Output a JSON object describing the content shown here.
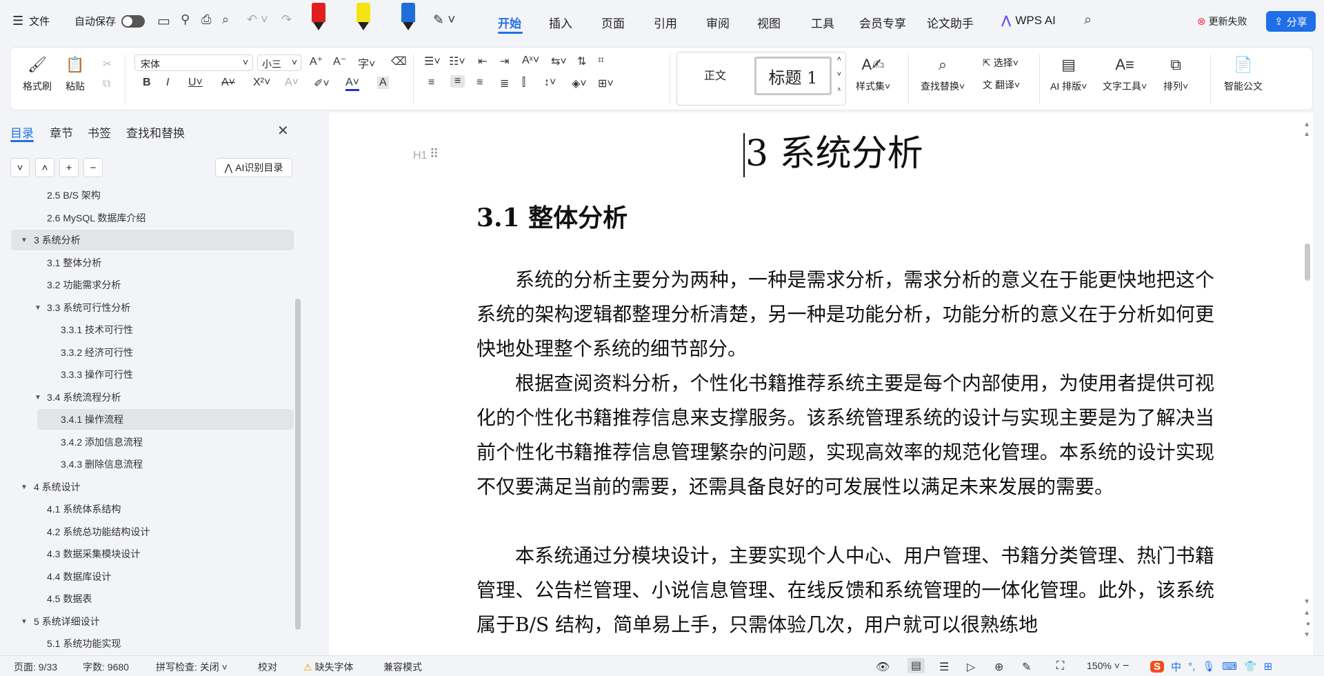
{
  "titlebar": {
    "file": "文件",
    "autosave": "自动保存",
    "menu": [
      "开始",
      "插入",
      "页面",
      "引用",
      "审阅",
      "视图",
      "工具",
      "会员专享",
      "论文助手"
    ],
    "wps_ai": "WPS AI",
    "update_failed": "更新失败",
    "share": "分享"
  },
  "ribbon": {
    "format_painter": "格式刷",
    "paste": "粘贴",
    "font_name": "宋体",
    "font_size": "小三",
    "style_normal": "正文",
    "style_heading": "标题 1",
    "style_set": "样式集",
    "find_replace": "查找替换",
    "select": "选择",
    "translate": "翻译",
    "ai_layout": "AI 排版",
    "text_tools": "文字工具",
    "arrange": "排列",
    "smart_doc": "智能公文"
  },
  "nav": {
    "tabs": [
      "目录",
      "章节",
      "书签",
      "查找和替换"
    ],
    "ai_toc": "AI识别目录",
    "items": [
      {
        "label": "2.5 B/S 架构"
      },
      {
        "label": "2.6 MySQL 数据库介绍"
      },
      {
        "label": "3 系统分析"
      },
      {
        "label": "3.1 整体分析"
      },
      {
        "label": "3.2 功能需求分析"
      },
      {
        "label": "3.3  系统可行性分析"
      },
      {
        "label": "3.3.1 技术可行性"
      },
      {
        "label": "3.3.2 经济可行性"
      },
      {
        "label": "3.3.3 操作可行性"
      },
      {
        "label": "3.4 系统流程分析"
      },
      {
        "label": "3.4.1 操作流程"
      },
      {
        "label": "3.4.2 添加信息流程"
      },
      {
        "label": "3.4.3 删除信息流程"
      },
      {
        "label": "4  系统设计"
      },
      {
        "label": "4.1  系统体系结构"
      },
      {
        "label": "4.2  系统总功能结构设计"
      },
      {
        "label": "4.3  数据采集模块设计"
      },
      {
        "label": "4.4  数据库设计"
      },
      {
        "label": "4.5  数据表"
      },
      {
        "label": "5  系统详细设计"
      },
      {
        "label": "5.1 系统功能实现"
      }
    ]
  },
  "document": {
    "heading_marker": "H1",
    "h1": "3 系统分析",
    "h2": "3.1 整体分析",
    "paragraphs": [
      "系统的分析主要分为两种，一种是需求分析，需求分析的意义在于能更快地把这个系统的架构逻辑都整理分析清楚，另一种是功能分析，功能分析的意义在于分析如何更快地处理整个系统的细节部分。",
      "根据查阅资料分析，个性化书籍推荐系统主要是每个内部使用，为使用者提供可视化的个性化书籍推荐信息来支撑服务。该系统管理系统的设计与实现主要是为了解决当前个性化书籍推荐信息管理繁杂的问题，实现高效率的规范化管理。本系统的设计实现不仅要满足当前的需要，还需具备良好的可发展性以满足未来发展的需要。",
      "本系统通过分模块设计，主要实现个人中心、用户管理、书籍分类管理、热门书籍管理、公告栏管理、小说信息管理、在线反馈和系统管理的一体化管理。此外，该系统属于B/S 结构，简单易上手，只需体验几次，用户就可以很熟练地"
    ]
  },
  "status": {
    "page": "页面: 9/33",
    "words": "字数: 9680",
    "spell": "拼写检查: 关闭",
    "proof": "校对",
    "missing_font": "缺失字体",
    "compat": "兼容模式",
    "zoom": "150%"
  },
  "ime": {
    "lang": "中"
  },
  "colors": {
    "accent": "#1f6fe8",
    "highlighter_red": "#e02020",
    "highlighter_yellow": "#f5e414",
    "highlighter_blue": "#1e6fd9"
  }
}
